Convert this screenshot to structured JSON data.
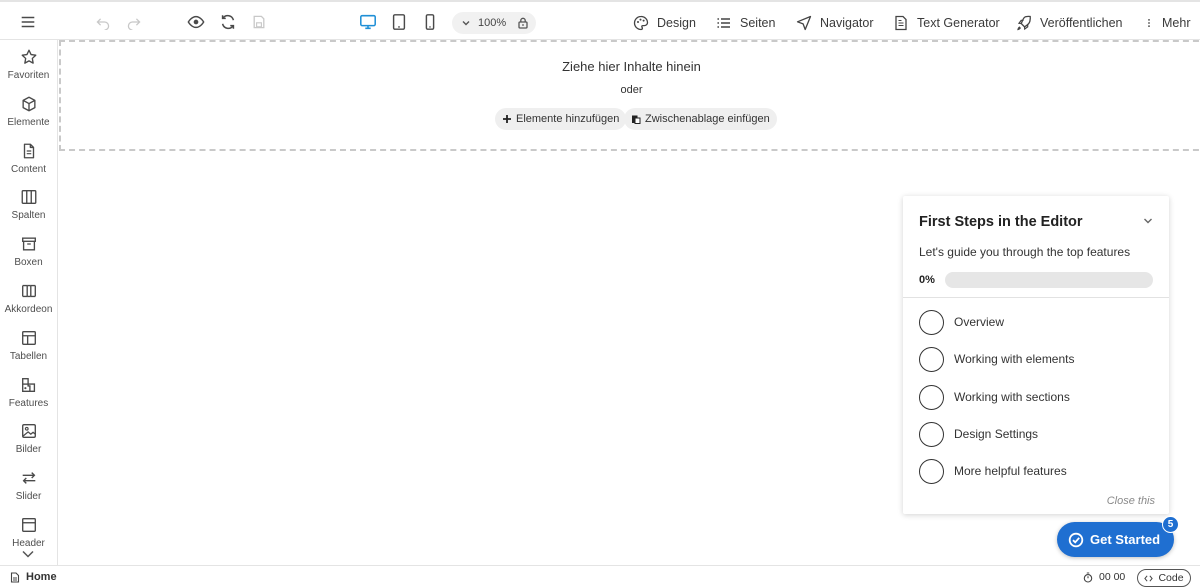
{
  "toolbar": {
    "zoom_value": "100%",
    "design_label": "Design",
    "pages_label": "Seiten",
    "navigator_label": "Navigator",
    "text_generator_label": "Text Generator",
    "publish_label": "Veröffentlichen",
    "more_label": "Mehr",
    "active_device": "desktop",
    "accent_color": "#1f8fd6"
  },
  "sidebar": {
    "items": [
      {
        "label": "Favoriten",
        "icon": "star-icon"
      },
      {
        "label": "Elemente",
        "icon": "cube-icon"
      },
      {
        "label": "Content",
        "icon": "document-icon"
      },
      {
        "label": "Spalten",
        "icon": "columns-icon"
      },
      {
        "label": "Boxen",
        "icon": "box-icon"
      },
      {
        "label": "Akkordeon",
        "icon": "accordion-icon"
      },
      {
        "label": "Tabellen",
        "icon": "table-icon"
      },
      {
        "label": "Features",
        "icon": "features-icon"
      },
      {
        "label": "Bilder",
        "icon": "image-icon"
      },
      {
        "label": "Slider",
        "icon": "slider-icon"
      },
      {
        "label": "Header",
        "icon": "header-icon"
      }
    ]
  },
  "dropzone": {
    "title": "Ziehe hier Inhalte hinein",
    "or_text": "oder",
    "add_elements_label": "Elemente hinzufügen",
    "paste_clipboard_label": "Zwischenablage einfügen"
  },
  "first_steps": {
    "title": "First Steps in the Editor",
    "subtitle": "Let's guide you through the top features",
    "progress_label": "0%",
    "progress_fraction": 0,
    "steps": [
      {
        "label": "Overview",
        "done": false
      },
      {
        "label": "Working with elements",
        "done": false
      },
      {
        "label": "Working with sections",
        "done": false
      },
      {
        "label": "Design Settings",
        "done": false
      },
      {
        "label": "More helpful features",
        "done": false
      }
    ],
    "close_label": "Close this",
    "brand_color": "#1f6fd1"
  },
  "get_started": {
    "label": "Get Started",
    "badge_count": "5"
  },
  "statusbar": {
    "page_label": "Home",
    "timer": "00 00",
    "code_label": "Code"
  }
}
